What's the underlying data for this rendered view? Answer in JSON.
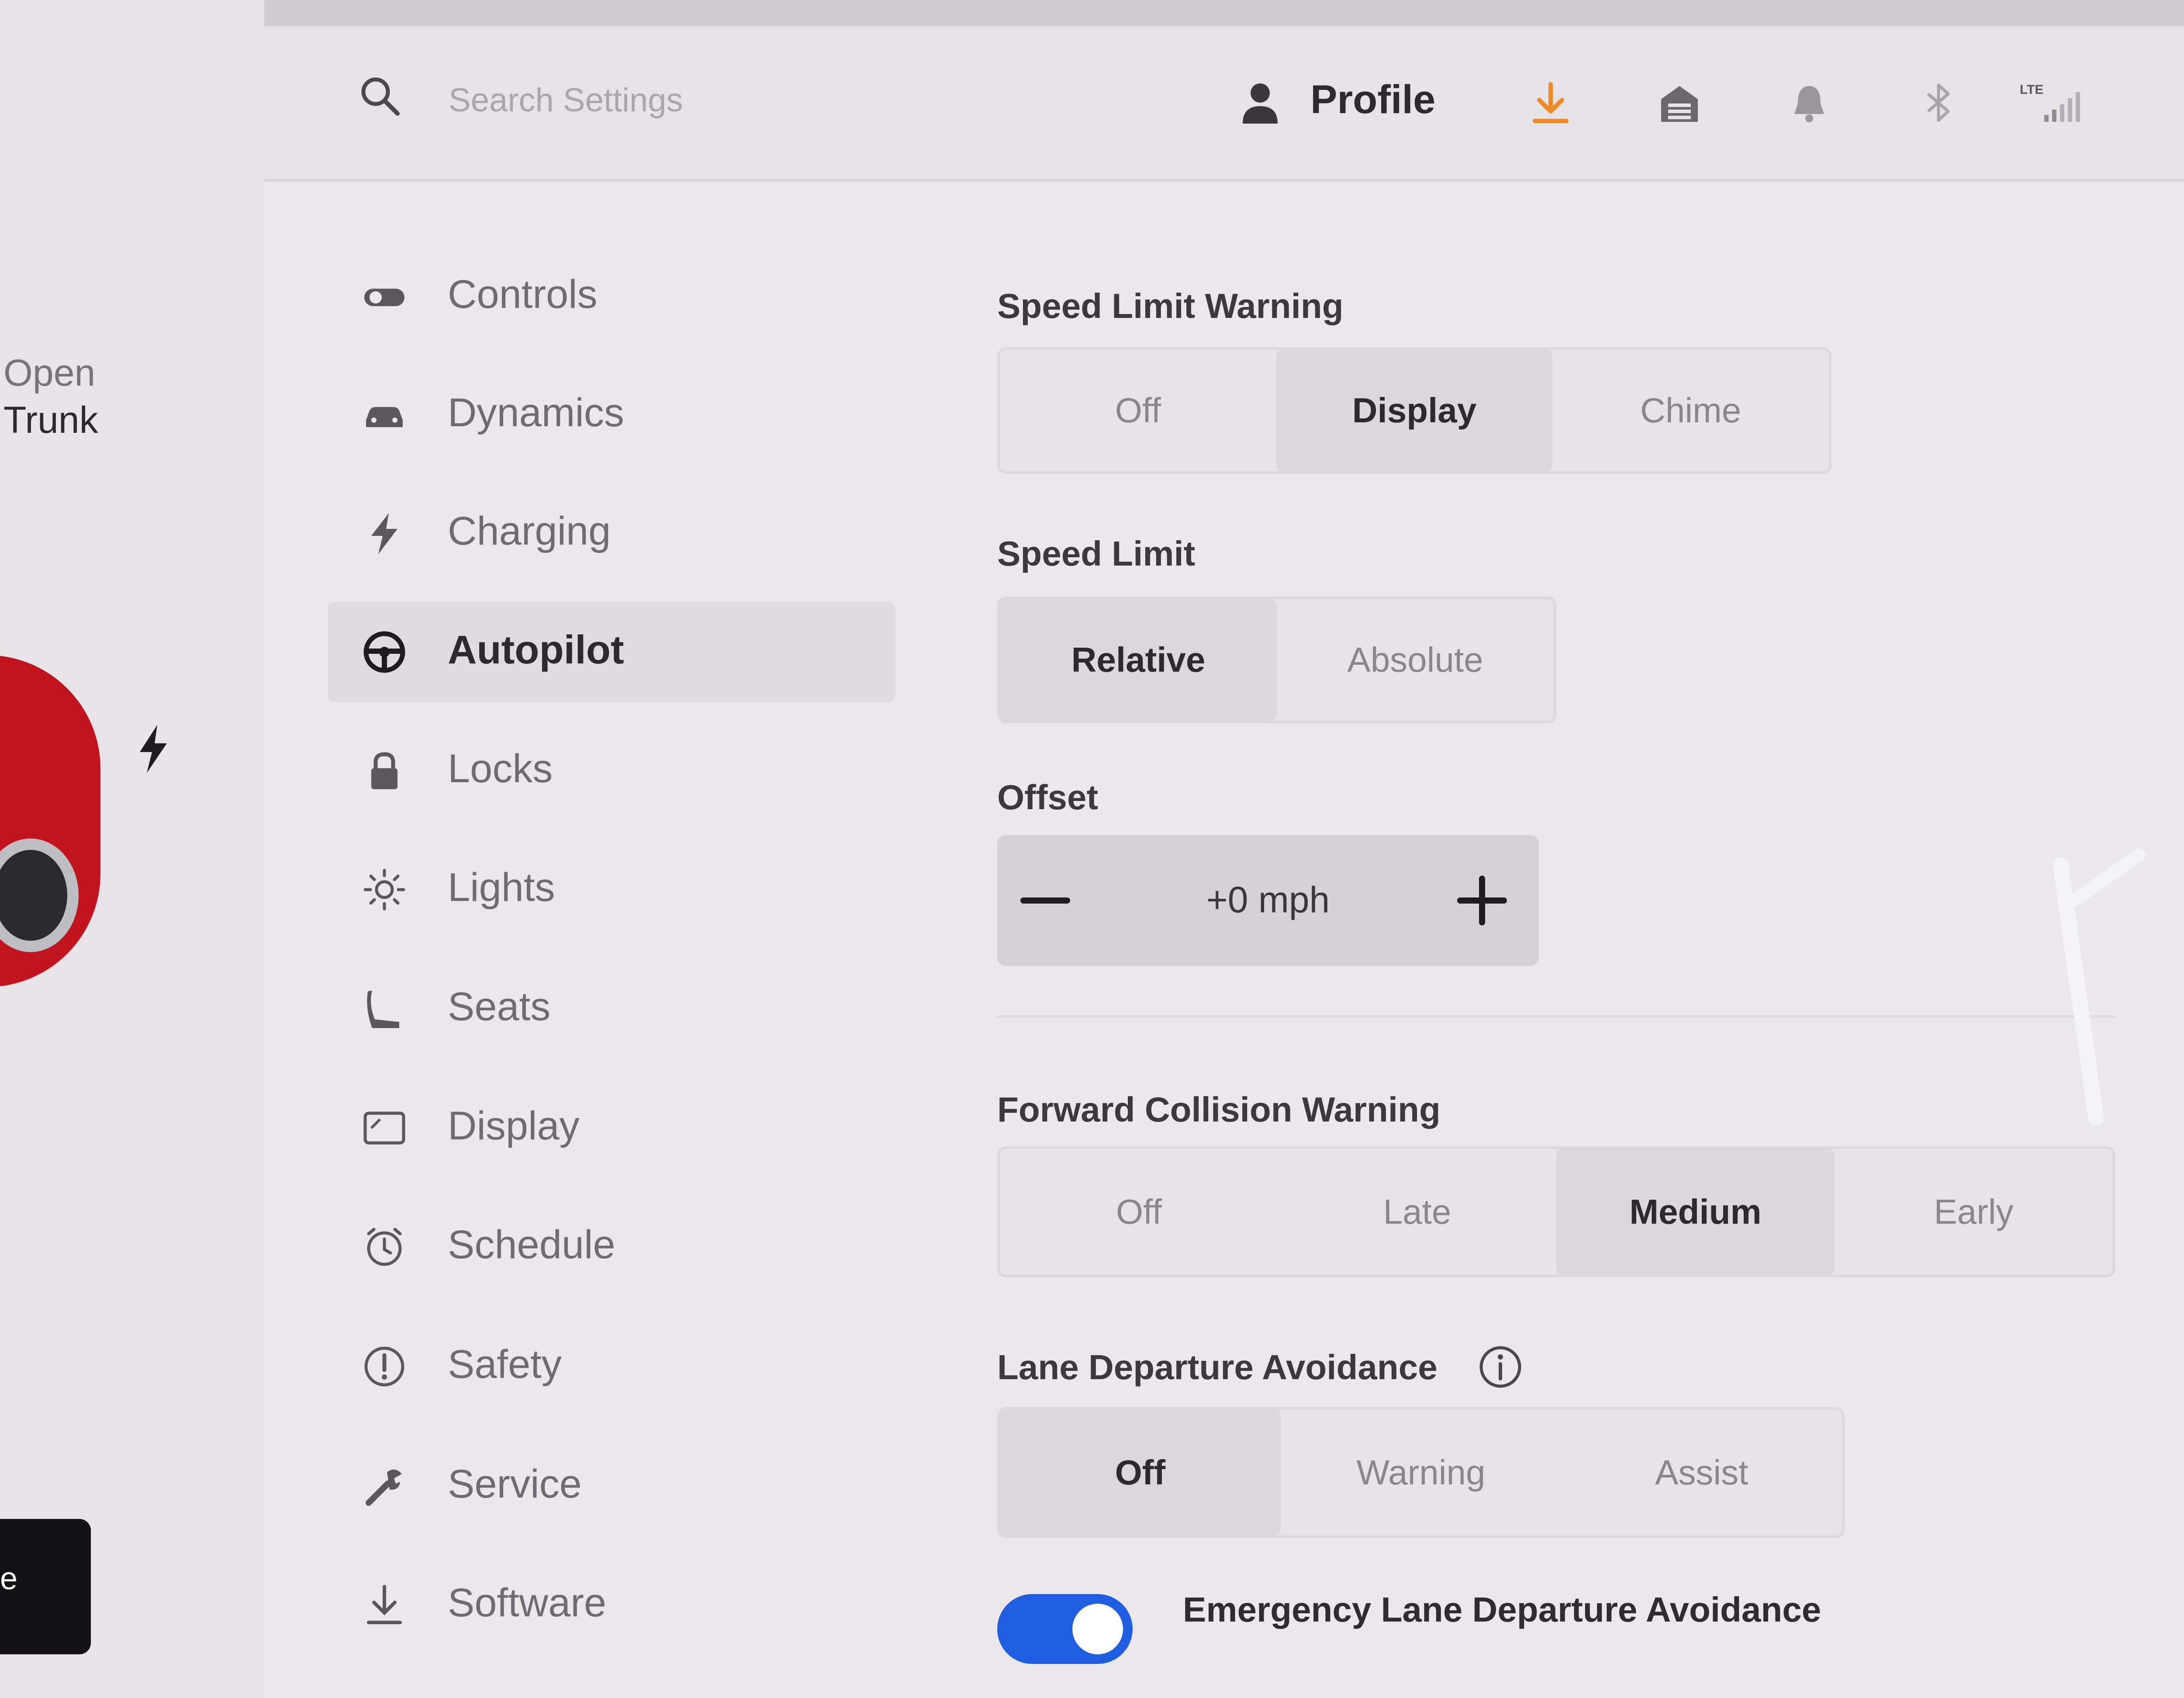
{
  "left_panel": {
    "open_trunk_line1": "Open",
    "open_trunk_line2": "Trunk",
    "black_tab_text": "e"
  },
  "topbar": {
    "search_placeholder": "Search Settings",
    "profile_label": "Profile",
    "download_color": "#f08a24",
    "lte_label": "LTE"
  },
  "sidebar": {
    "items": [
      {
        "label": "Controls",
        "icon": "toggle-icon"
      },
      {
        "label": "Dynamics",
        "icon": "car-icon"
      },
      {
        "label": "Charging",
        "icon": "bolt-icon"
      },
      {
        "label": "Autopilot",
        "icon": "steering-wheel-icon",
        "active": true
      },
      {
        "label": "Locks",
        "icon": "lock-icon"
      },
      {
        "label": "Lights",
        "icon": "sun-icon"
      },
      {
        "label": "Seats",
        "icon": "seat-icon"
      },
      {
        "label": "Display",
        "icon": "display-icon"
      },
      {
        "label": "Schedule",
        "icon": "alarm-clock-icon"
      },
      {
        "label": "Safety",
        "icon": "alert-icon"
      },
      {
        "label": "Service",
        "icon": "wrench-icon"
      },
      {
        "label": "Software",
        "icon": "download-icon"
      }
    ]
  },
  "settings": {
    "speed_limit_warning": {
      "title": "Speed Limit Warning",
      "options": [
        "Off",
        "Display",
        "Chime"
      ],
      "selected": "Display"
    },
    "speed_limit": {
      "title": "Speed Limit",
      "options": [
        "Relative",
        "Absolute"
      ],
      "selected": "Relative"
    },
    "offset": {
      "title": "Offset",
      "value": "+0 mph"
    },
    "forward_collision_warning": {
      "title": "Forward Collision Warning",
      "options": [
        "Off",
        "Late",
        "Medium",
        "Early"
      ],
      "selected": "Medium"
    },
    "lane_departure_avoidance": {
      "title": "Lane Departure Avoidance",
      "options": [
        "Off",
        "Warning",
        "Assist"
      ],
      "selected": "Off"
    },
    "emergency_lane_departure": {
      "label": "Emergency Lane Departure Avoidance",
      "enabled": true,
      "toggle_color": "#1f5ee0"
    }
  }
}
